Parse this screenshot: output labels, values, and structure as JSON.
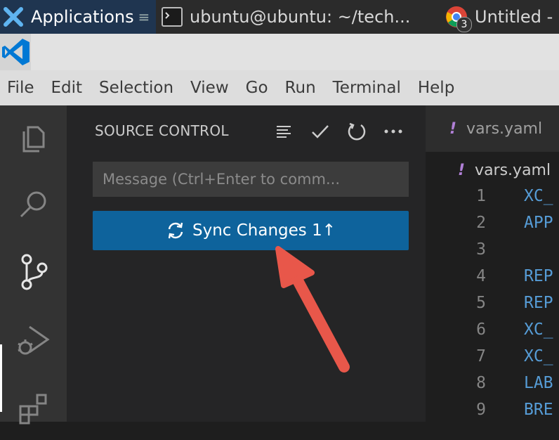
{
  "taskbar": {
    "applications": "Applications",
    "terminal": "ubuntu@ubuntu: ~/tech...",
    "chrome": "Untitled -",
    "chrome_badge": "3"
  },
  "menu": [
    "File",
    "Edit",
    "Selection",
    "View",
    "Go",
    "Run",
    "Terminal",
    "Help"
  ],
  "activity_bar": [
    "explorer-icon",
    "search-icon",
    "source-control-icon",
    "run-debug-icon",
    "extensions-icon"
  ],
  "source_control": {
    "title": "SOURCE CONTROL",
    "message_placeholder": "Message (Ctrl+Enter to comm...",
    "sync_label": "Sync Changes 1↑"
  },
  "editor": {
    "tab_name": "vars.yaml",
    "breadcrumb": "vars.yaml",
    "lines": [
      {
        "n": "1",
        "text": "XC_"
      },
      {
        "n": "2",
        "text": "APP"
      },
      {
        "n": "3",
        "text": ""
      },
      {
        "n": "4",
        "text": "REP"
      },
      {
        "n": "5",
        "text": "REP"
      },
      {
        "n": "6",
        "text": "XC_"
      },
      {
        "n": "7",
        "text": "XC_"
      },
      {
        "n": "8",
        "text": "LAB"
      },
      {
        "n": "9",
        "text": "BRE"
      }
    ]
  },
  "colors": {
    "accent_button": "#0e639c",
    "arrow": "#e8574a",
    "yaml_icon": "#b180d7"
  }
}
